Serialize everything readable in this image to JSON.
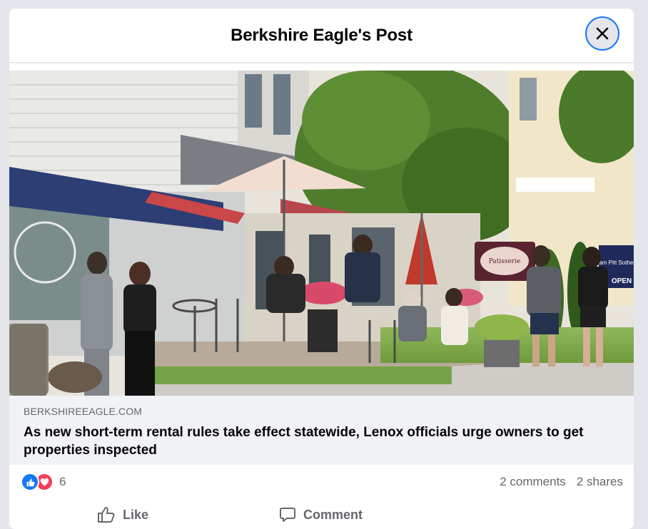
{
  "header": {
    "title": "Berkshire Eagle's Post",
    "close_icon": "close-icon"
  },
  "link_preview": {
    "domain": "BERKSHIREEAGLE.COM",
    "title": "As new short-term rental rules take effect statewide, Lenox officials urge owners to get properties inspected",
    "photo_description_icon": "photo",
    "photo_signs": {
      "cafe_sign": "Patisserie",
      "realtor_sign": "William Pitt Sotheby's",
      "open_sign": "OPEN"
    }
  },
  "stats": {
    "reaction_icons": [
      "like-reaction-icon",
      "love-reaction-icon"
    ],
    "reaction_count": "6",
    "comments": "2 comments",
    "shares": "2 shares"
  },
  "actions": {
    "like_label": "Like",
    "comment_label": "Comment"
  },
  "colors": {
    "accent": "#1877f2",
    "love": "#f33e58",
    "secondary_text": "#65676b",
    "card_bg": "#f0f2f5"
  }
}
